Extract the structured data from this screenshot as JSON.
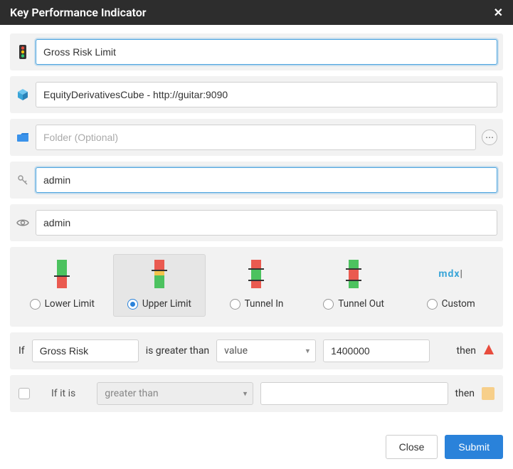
{
  "title": "Key Performance Indicator",
  "fields": {
    "name": "Gross Risk Limit",
    "cube": "EquityDerivativesCube - http://guitar:9090",
    "folder_placeholder": "Folder (Optional)",
    "owner": "admin",
    "viewer": "admin"
  },
  "types": {
    "lower": "Lower Limit",
    "upper": "Upper Limit",
    "tunnel_in": "Tunnel In",
    "tunnel_out": "Tunnel Out",
    "custom": "Custom",
    "custom_glyph": "mdx",
    "selected": "upper"
  },
  "condition1": {
    "if": "If",
    "measure": "Gross Risk",
    "operator_text": "is greater than",
    "compare_type": "value",
    "compare_value": "1400000",
    "then": "then",
    "result_color": "#e84c3d"
  },
  "condition2": {
    "label": "If it is",
    "operator": "greater than",
    "then": "then",
    "result_color": "#f7cf8a"
  },
  "footer": {
    "close": "Close",
    "submit": "Submit"
  }
}
